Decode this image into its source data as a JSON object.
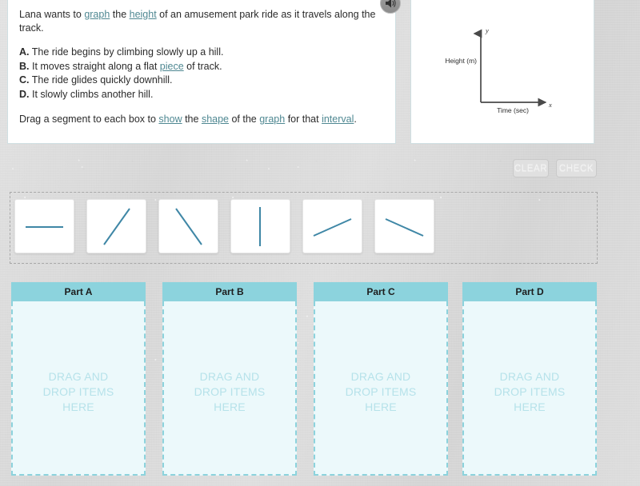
{
  "audio": {
    "icon": "speaker-icon",
    "label": "Play audio"
  },
  "question": {
    "intro_before_graph": "Lana wants to ",
    "gloss_graph": "graph",
    "intro_mid": " the ",
    "gloss_height": "height",
    "intro_after": " of an amusement park ride as it travels along the track.",
    "choices": [
      {
        "letter": "A.",
        "text_before": " The ride begins by climbing slowly up a hill.",
        "gloss": "",
        "text_after": ""
      },
      {
        "letter": "B.",
        "text_before": " It moves straight along a flat ",
        "gloss": "piece",
        "text_after": " of track."
      },
      {
        "letter": "C.",
        "text_before": " The ride glides quickly downhill.",
        "gloss": "",
        "text_after": ""
      },
      {
        "letter": "D.",
        "text_before": " It slowly climbs another hill.",
        "gloss": "",
        "text_after": ""
      }
    ],
    "instruction": {
      "p1": "Drag a segment to each box to ",
      "gloss_show": "show",
      "p2": " the ",
      "gloss_shape": "shape",
      "p3": " of the ",
      "gloss_graph": "graph",
      "p4": " for that ",
      "gloss_interval": "interval",
      "p5": "."
    }
  },
  "graph": {
    "y_axis_label": "Height (m)",
    "x_axis_label": "Time (sec)",
    "y_tip_label": "y",
    "x_tip_label": "x",
    "axis_color": "#4a4a4a"
  },
  "toolbar": {
    "clear_label": "CLEAR",
    "check_label": "CHECK"
  },
  "tray": {
    "segments": [
      {
        "name": "segment-horizontal",
        "description": "horizontal line"
      },
      {
        "name": "segment-steep-up",
        "description": "steep upward diagonal"
      },
      {
        "name": "segment-steep-down",
        "description": "steep downward diagonal"
      },
      {
        "name": "segment-vertical",
        "description": "vertical line"
      },
      {
        "name": "segment-shallow-up",
        "description": "shallow upward diagonal"
      },
      {
        "name": "segment-shallow-down",
        "description": "shallow downward diagonal"
      }
    ],
    "line_color": "#3f87a6"
  },
  "drop_zones": [
    {
      "title": "Part A",
      "placeholder": "DRAG AND\nDROP ITEMS\nHERE"
    },
    {
      "title": "Part B",
      "placeholder": "DRAG AND\nDROP ITEMS\nHERE"
    },
    {
      "title": "Part C",
      "placeholder": "DRAG AND\nDROP ITEMS\nHERE"
    },
    {
      "title": "Part D",
      "placeholder": "DRAG AND\nDROP ITEMS\nHERE"
    }
  ],
  "colors": {
    "header_teal": "#8cd3dd",
    "body_tint": "#ecf9fb",
    "placeholder_text": "#b6e2ea",
    "segment_line": "#3f87a6",
    "gloss_link": "#4f8892",
    "page_background": "#dadada"
  }
}
